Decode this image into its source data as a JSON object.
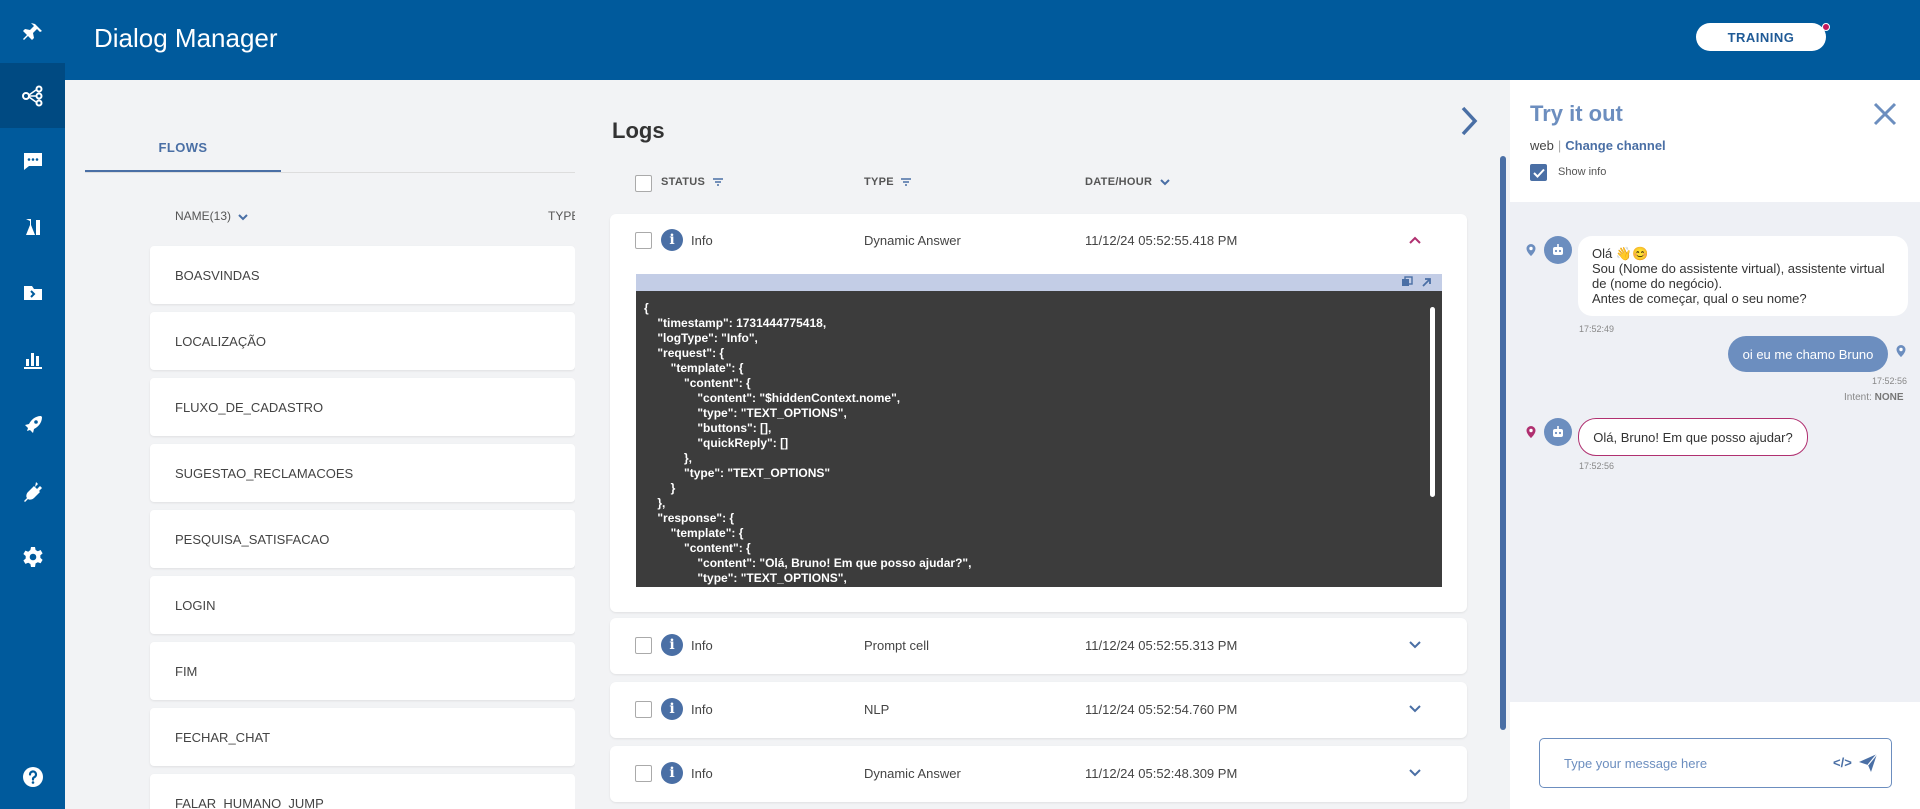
{
  "header": {
    "title": "Dialog Manager",
    "training_label": "TRAINING"
  },
  "sidebar": {
    "items": [
      {
        "icon": "pin-icon"
      },
      {
        "icon": "flow-icon",
        "active": true
      },
      {
        "icon": "chat-icon"
      },
      {
        "icon": "lab-icon"
      },
      {
        "icon": "knowledge-icon"
      },
      {
        "icon": "chart-icon"
      },
      {
        "icon": "rocket-icon"
      },
      {
        "icon": "plug-icon"
      },
      {
        "icon": "gear-icon"
      }
    ],
    "help_icon": "help-icon"
  },
  "flows": {
    "tab_label": "FLOWS",
    "col_name": "NAME(13)",
    "col_type": "TYPE",
    "rows": [
      "BOASVINDAS",
      "LOCALIZAÇÃO",
      "FLUXO_DE_CADASTRO",
      "SUGESTAO_RECLAMACOES",
      "PESQUISA_SATISFACAO",
      "LOGIN",
      "FIM",
      "FECHAR_CHAT",
      "FALAR_HUMANO_JUMP"
    ]
  },
  "logs": {
    "title": "Logs",
    "headers": {
      "status": "STATUS",
      "type": "TYPE",
      "date": "DATE/HOUR"
    },
    "entries": [
      {
        "status": "Info",
        "type": "Dynamic Answer",
        "date": "11/12/24 05:52:55.418 PM",
        "expanded": true
      },
      {
        "status": "Info",
        "type": "Prompt cell",
        "date": "11/12/24 05:52:55.313 PM",
        "expanded": false
      },
      {
        "status": "Info",
        "type": "NLP",
        "date": "11/12/24 05:52:54.760 PM",
        "expanded": false
      },
      {
        "status": "Info",
        "type": "Dynamic Answer",
        "date": "11/12/24 05:52:48.309 PM",
        "expanded": false
      }
    ],
    "code": "{\n    \"timestamp\": 1731444775418,\n    \"logType\": \"Info\",\n    \"request\": {\n        \"template\": {\n            \"content\": {\n                \"content\": \"$hiddenContext.nome\",\n                \"type\": \"TEXT_OPTIONS\",\n                \"buttons\": [],\n                \"quickReply\": []\n            },\n            \"type\": \"TEXT_OPTIONS\"\n        }\n    },\n    \"response\": {\n        \"template\": {\n            \"content\": {\n                \"content\": \"Olá, Bruno! Em que posso ajudar?\",\n                \"type\": \"TEXT_OPTIONS\","
  },
  "tryit": {
    "title": "Try it out",
    "channel": "web",
    "change_channel": "Change channel",
    "show_info": "Show info",
    "messages": {
      "bot1_line1": "Olá 👋😊",
      "bot1_line2": "Sou (Nome do assistente virtual), assistente virtual de (nome do negócio).",
      "bot1_line3": "Antes de começar, qual o seu nome?",
      "bot1_time": "17:52:49",
      "user1": "oi eu me chamo Bruno",
      "user1_time": "17:52:56",
      "intent_label": "Intent:",
      "intent_value": "NONE",
      "bot2": "Olá, Bruno! Em que posso ajudar?",
      "bot2_time": "17:52:56"
    },
    "input_placeholder": "Type your message here",
    "code_symbol": "</>"
  },
  "colors": {
    "primary": "#005a9c",
    "accent": "#4a6fa5",
    "soft_accent": "#6c8ebf",
    "bot_highlight": "#b03070"
  }
}
